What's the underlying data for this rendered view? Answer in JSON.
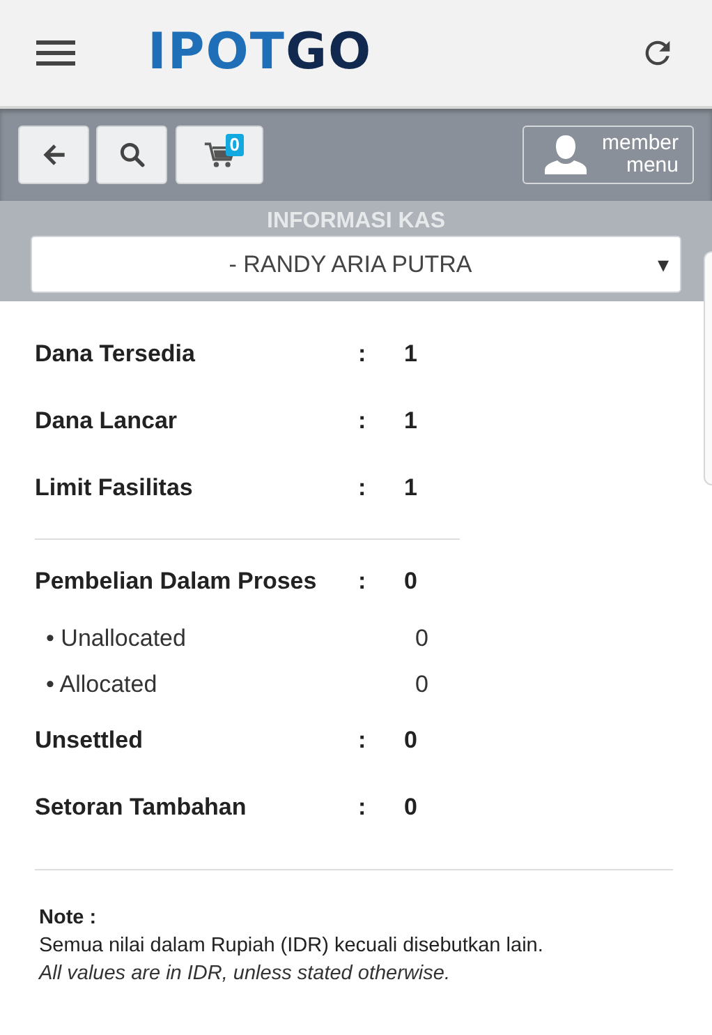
{
  "header": {
    "logo_primary": "IPOT",
    "logo_secondary": "GO"
  },
  "toolbar": {
    "cart_count": "0",
    "member_menu": [
      "member",
      "menu"
    ]
  },
  "section_title": "INFORMASI KAS",
  "account_select": {
    "value": "- RANDY ARIA PUTRA",
    "arrow": "▾"
  },
  "groups": [
    [
      {
        "kind": "main",
        "label": "Dana Tersedia",
        "separator": ":",
        "value": "1"
      },
      {
        "kind": "main",
        "label": "Dana Lancar",
        "separator": ":",
        "value": "1"
      },
      {
        "kind": "main",
        "label": "Limit Fasilitas",
        "separator": ":",
        "value": "1"
      }
    ],
    [
      {
        "kind": "main",
        "label": "Pembelian Dalam Proses",
        "separator": ":",
        "value": "0"
      },
      {
        "kind": "sub",
        "label": "• Unallocated",
        "value": "0"
      },
      {
        "kind": "sub",
        "label": "• Allocated",
        "value": "0"
      },
      {
        "kind": "main",
        "label": "Unsettled",
        "separator": ":",
        "value": "0"
      },
      {
        "kind": "main",
        "label": "Setoran Tambahan",
        "separator": ":",
        "value": "0"
      }
    ]
  ],
  "note": {
    "title": "Note :",
    "lines": [
      "Semua nilai dalam Rupiah (IDR) kecuali disebutkan lain.",
      "All values are in IDR, unless stated otherwise."
    ]
  }
}
